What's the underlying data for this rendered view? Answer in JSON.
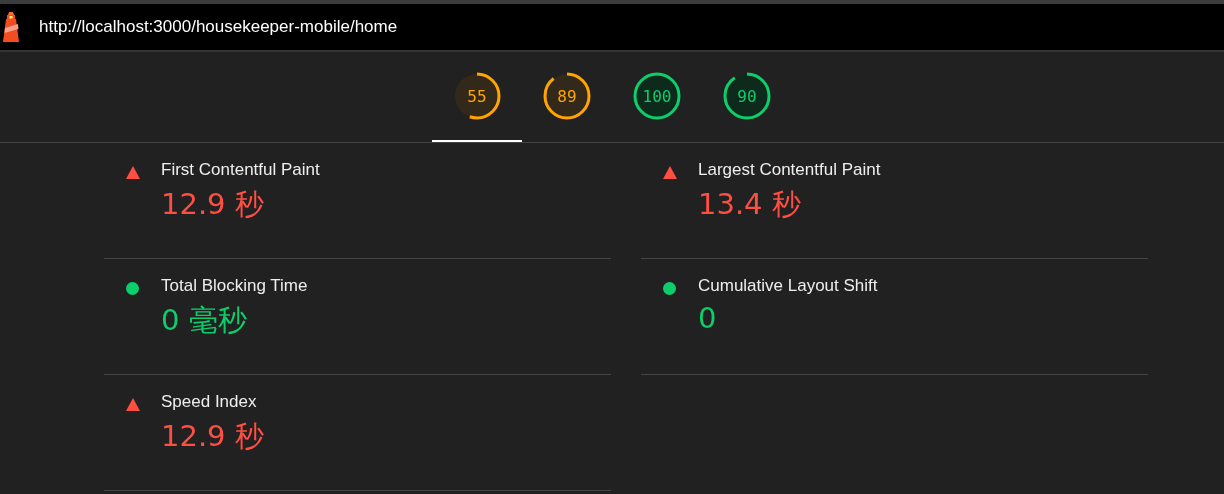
{
  "address_bar": {
    "url": "http://localhost:3000/housekeeper-mobile/home"
  },
  "gauges": [
    {
      "score": "55",
      "selected": true
    },
    {
      "score": "89",
      "selected": false
    },
    {
      "score": "100",
      "selected": false
    },
    {
      "score": "90",
      "selected": false
    }
  ],
  "metrics": [
    {
      "title": "First Contentful Paint",
      "value": "12.9 秒",
      "kind": "fail"
    },
    {
      "title": "Largest Contentful Paint",
      "value": "13.4 秒",
      "kind": "fail"
    },
    {
      "title": "Total Blocking Time",
      "value": "0 毫秒",
      "kind": "pass"
    },
    {
      "title": "Cumulative Layout Shift",
      "value": "0",
      "kind": "pass"
    },
    {
      "title": "Speed Index",
      "value": "12.9 秒",
      "kind": "fail"
    }
  ]
}
